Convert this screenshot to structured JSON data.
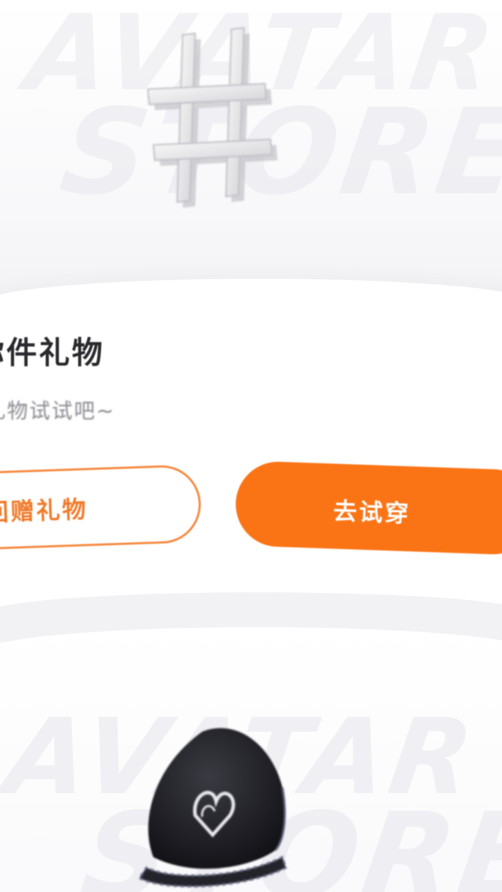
{
  "gift": {
    "title": "你件礼物",
    "subtitle": "礼物试试吧~",
    "return_gift_label": "回赠礼物",
    "try_on_label": "去试穿"
  },
  "decor": {
    "watermark_top_line1": "AVATAR",
    "watermark_top_line2": "STORE",
    "watermark_bottom_line1": "AVATAR",
    "watermark_bottom_line2": "STORE"
  },
  "colors": {
    "accent": "#fa7415",
    "outline": "#f5873a",
    "title": "#2a2a2e",
    "subtitle": "#8a8a90"
  },
  "icons": {
    "hero_item": "hashtag-3d-icon",
    "preview_item": "cap-icon"
  }
}
